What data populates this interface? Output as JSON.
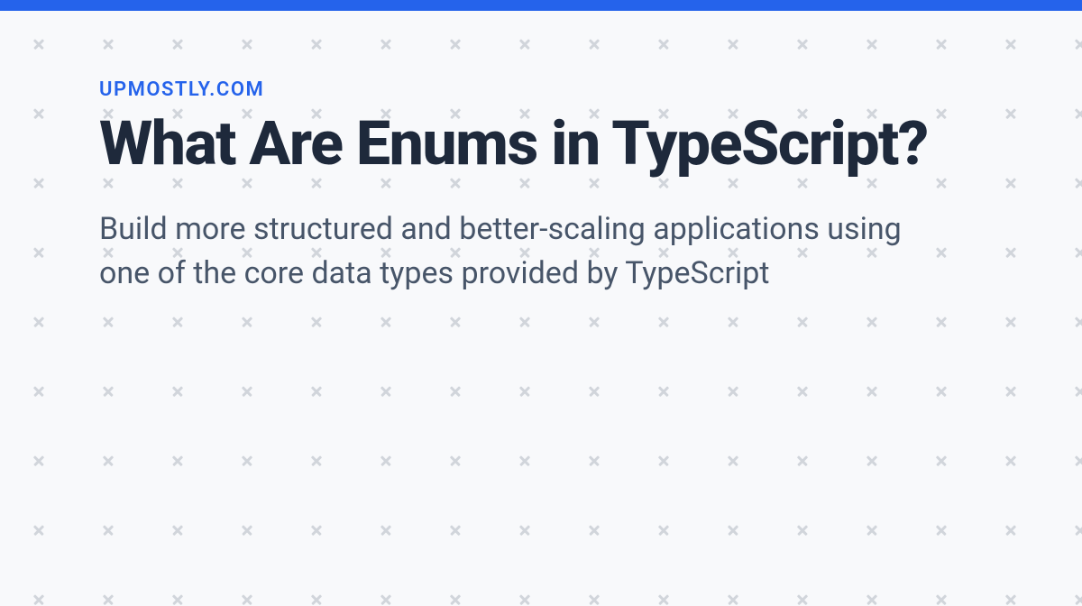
{
  "header": {
    "site_name": "UPMOSTLY.COM"
  },
  "article": {
    "title": "What Are Enums in TypeScript?",
    "description": "Build more structured and better-scaling applications using one of the core data types provided by TypeScript"
  },
  "colors": {
    "accent": "#2563eb",
    "title_color": "#1e293b",
    "body_color": "#475569",
    "pattern_color": "#d1d5db",
    "background": "#f8f9fb"
  }
}
